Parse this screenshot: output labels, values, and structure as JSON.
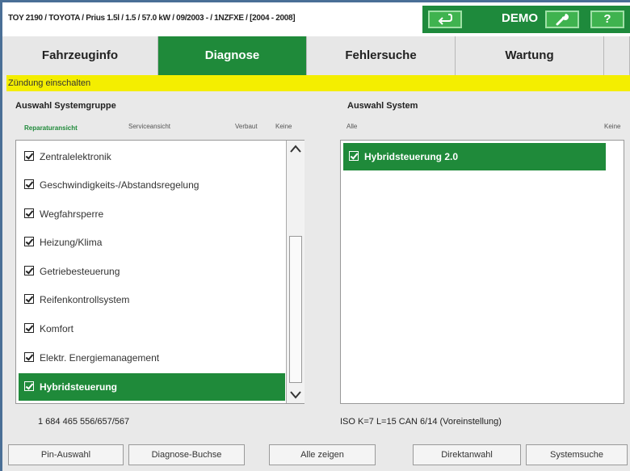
{
  "header": {
    "vehicle_info": "TOY 2190 / TOYOTA / Prius 1.5l / 1.5 / 57.0 kW / 09/2003 - / 1NZFXE / [2004 - 2008]",
    "back_icon": "back-arrow-icon",
    "mode_label": "DEMO",
    "wrench_icon": "wrench-icon",
    "help_label": "?"
  },
  "tabs": [
    {
      "label": "Fahrzeuginfo"
    },
    {
      "label": "Diagnose"
    },
    {
      "label": "Fehlersuche"
    },
    {
      "label": "Wartung"
    }
  ],
  "active_tab": "Diagnose",
  "status_message": "Zündung einschalten",
  "left_panel": {
    "title": "Auswahl Systemgruppe",
    "filters": [
      "Reparaturansicht",
      "Serviceansicht",
      "Verbaut",
      "Keine"
    ],
    "items": [
      {
        "label": "Zentralelektronik",
        "checked": true
      },
      {
        "label": "Geschwindigkeits-/Abstandsregelung",
        "checked": true
      },
      {
        "label": "Wegfahrsperre",
        "checked": true
      },
      {
        "label": "Heizung/Klima",
        "checked": true
      },
      {
        "label": "Getriebesteuerung",
        "checked": true
      },
      {
        "label": "Reifenkontrollsystem",
        "checked": true
      },
      {
        "label": "Komfort",
        "checked": true
      },
      {
        "label": "Elektr. Energiemanagement",
        "checked": true
      },
      {
        "label": "Hybridsteuerung",
        "checked": true
      }
    ],
    "selected_item": "Hybridsteuerung",
    "footer_info": "1 684 465 556/657/567"
  },
  "right_panel": {
    "title": "Auswahl System",
    "filters": [
      "Alle",
      "Keine"
    ],
    "items": [
      {
        "label": "Hybridsteuerung 2.0",
        "checked": true
      }
    ],
    "selected_item": "Hybridsteuerung 2.0",
    "footer_info": "ISO K=7 L=15 CAN 6/14 (Voreinstellung)"
  },
  "buttons": {
    "pin": "Pin-Auswahl",
    "socket": "Diagnose-Buchse",
    "show_all": "Alle zeigen",
    "direct": "Direktanwahl",
    "search": "Systemsuche"
  },
  "colors": {
    "primary_green": "#1f8a3a",
    "status_yellow": "#f4ee00",
    "frame_blue": "#4a6f96"
  }
}
